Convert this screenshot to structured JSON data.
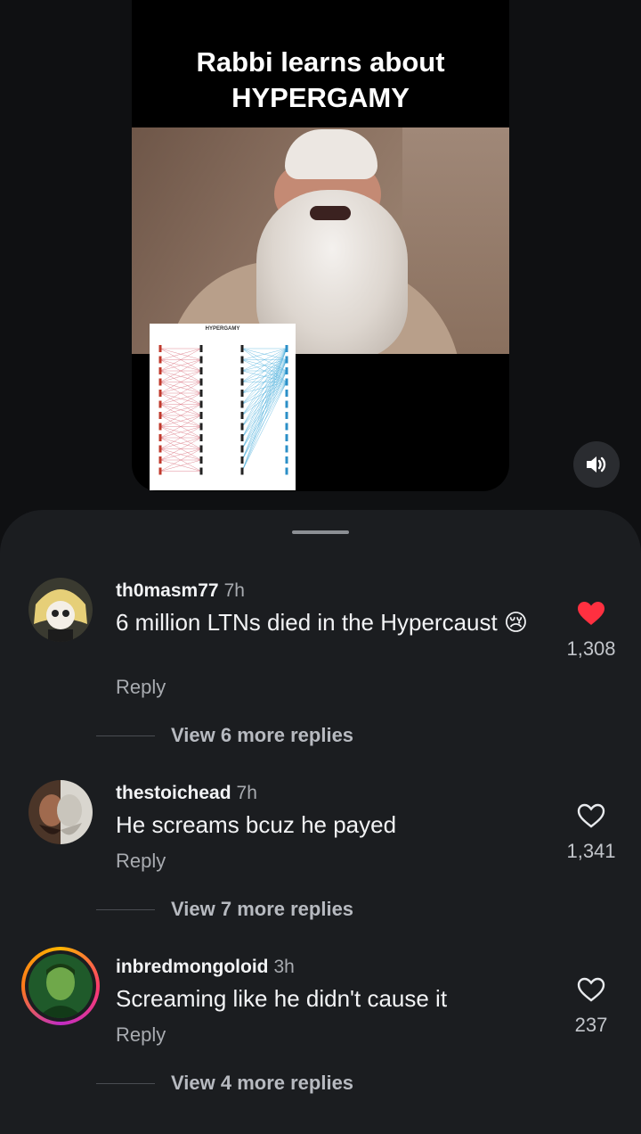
{
  "video": {
    "title_line1": "Rabbi learns about",
    "title_line2": "HYPERGAMY",
    "diagram_title": "HYPERGAMY",
    "sound_icon": "speaker-on-icon"
  },
  "comments": [
    {
      "username": "th0masm77",
      "time": "7h",
      "text": "6 million LTNs died in the Hypercaust 😢",
      "reply_label": "Reply",
      "likes": "1,308",
      "liked": true,
      "more_replies": "View 6 more replies"
    },
    {
      "username": "thestoichead",
      "time": "7h",
      "text": "He screams bcuz he payed",
      "reply_label": "Reply",
      "likes": "1,341",
      "liked": false,
      "more_replies": "View 7 more replies"
    },
    {
      "username": "inbredmongoloid",
      "time": "3h",
      "text": "Screaming like he didn't cause it",
      "reply_label": "Reply",
      "likes": "237",
      "liked": false,
      "more_replies": "View 4 more replies"
    }
  ],
  "colors": {
    "like_active": "#ff3040",
    "background": "#0f1012",
    "sheet": "#1b1d20"
  }
}
